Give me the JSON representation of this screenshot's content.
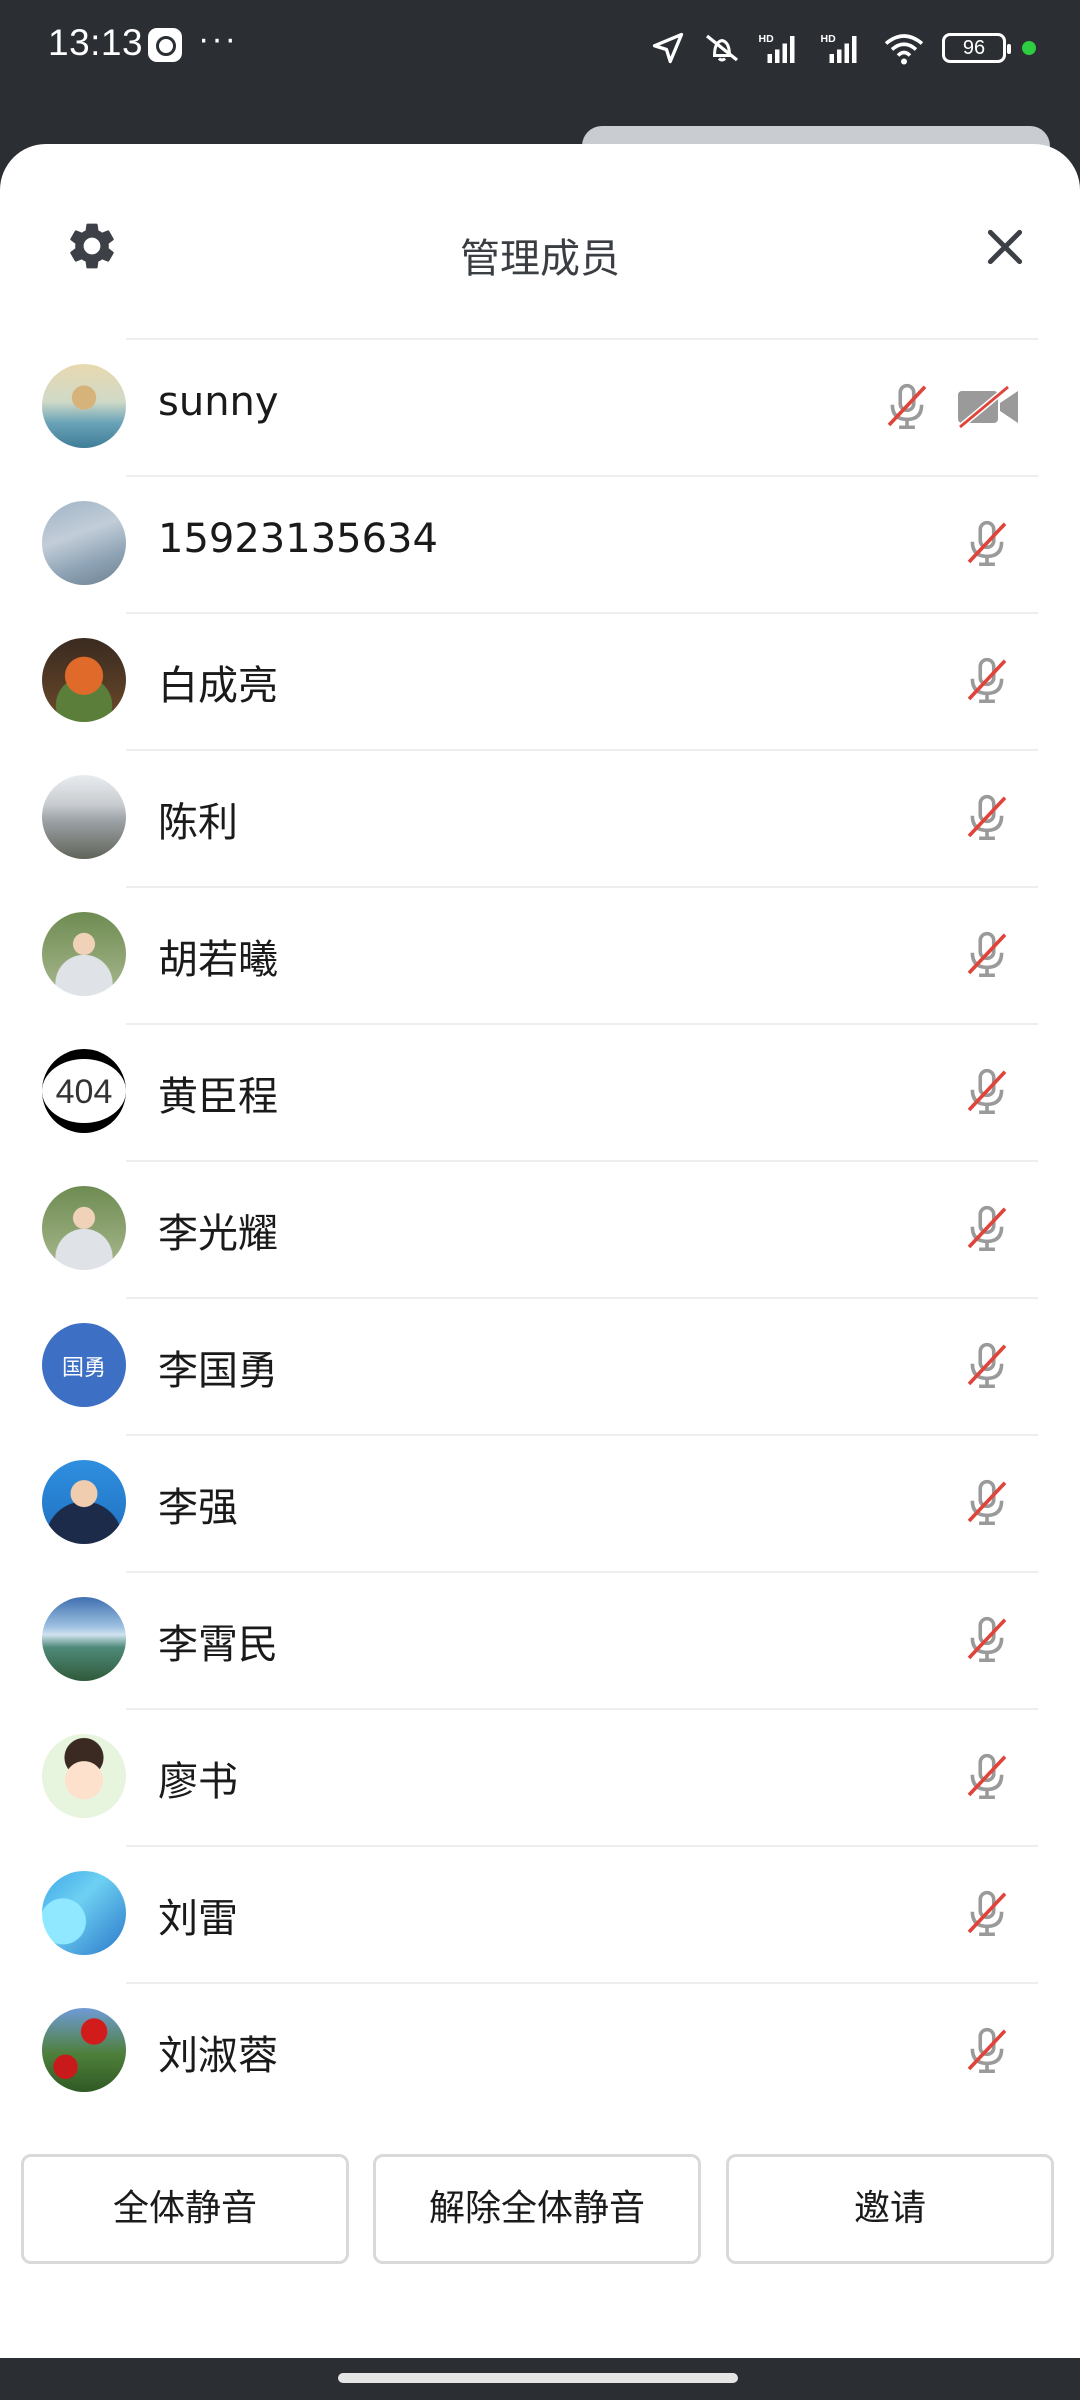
{
  "status_bar": {
    "time": "13:13",
    "more": "···",
    "battery": "96"
  },
  "header": {
    "title": "管理成员"
  },
  "members": [
    {
      "name": "sunny",
      "mic_muted": true,
      "camera_off": true,
      "avatar": "landscape-painting"
    },
    {
      "name": "15923135634",
      "mic_muted": true,
      "avatar": "sky-photo"
    },
    {
      "name": "白成亮",
      "mic_muted": true,
      "avatar": "fox-cartoon"
    },
    {
      "name": "陈利",
      "mic_muted": true,
      "avatar": "building-photo"
    },
    {
      "name": "胡若曦",
      "mic_muted": true,
      "avatar": "person-photo"
    },
    {
      "name": "黄臣程",
      "mic_muted": true,
      "avatar": "404-text",
      "avatar_text": "404"
    },
    {
      "name": "李光耀",
      "mic_muted": true,
      "avatar": "person-photo"
    },
    {
      "name": "李国勇",
      "mic_muted": true,
      "avatar": "initials",
      "avatar_text": "国勇"
    },
    {
      "name": "李强",
      "mic_muted": true,
      "avatar": "portrait-photo"
    },
    {
      "name": "李霄民",
      "mic_muted": true,
      "avatar": "lake-photo"
    },
    {
      "name": "廖书",
      "mic_muted": true,
      "avatar": "cartoon-boy"
    },
    {
      "name": "刘雷",
      "mic_muted": true,
      "avatar": "blue-abstract"
    },
    {
      "name": "刘淑蓉",
      "mic_muted": true,
      "avatar": "flower-photo"
    }
  ],
  "footer": {
    "mute_all": "全体静音",
    "unmute_all": "解除全体静音",
    "invite": "邀请"
  },
  "colors": {
    "muted_slash": "#e0433a",
    "icon_gray": "#9a9a9a",
    "initials_avatar_bg": "#3d6fc4",
    "online_dot": "#2ecc40"
  }
}
